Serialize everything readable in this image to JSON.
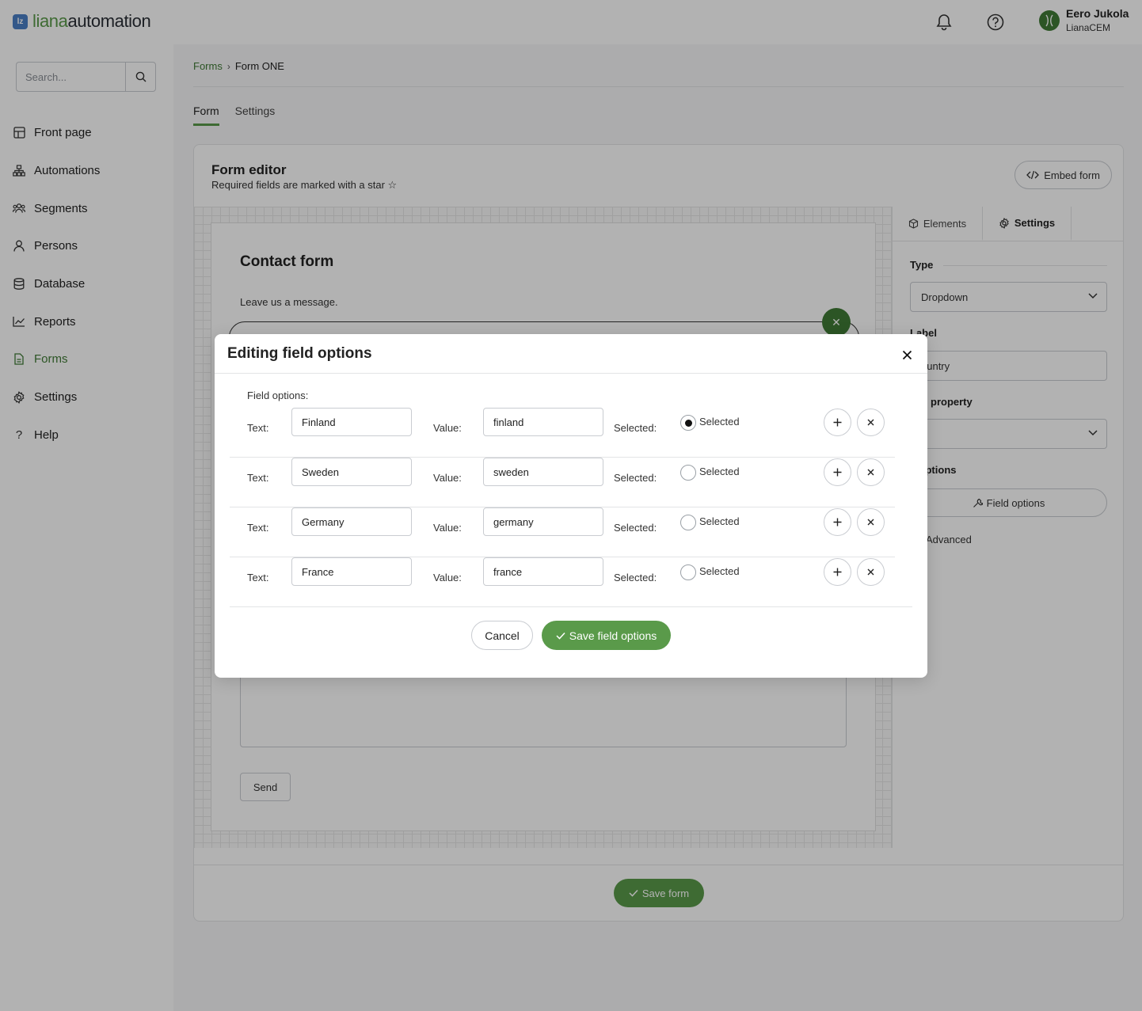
{
  "brand": {
    "logo_mark": "lz",
    "name_part1": "liana",
    "name_part2": "automation",
    "color": "#5a9a4a"
  },
  "topbar": {
    "notifications_icon": "bell-icon",
    "help_icon": "question-circle-icon"
  },
  "user": {
    "name": "Eero Jukola",
    "org": "LianaCEM"
  },
  "search": {
    "placeholder": "Search..."
  },
  "sidebar": {
    "items": [
      {
        "label": "Front page",
        "icon": "grid-icon"
      },
      {
        "label": "Automations",
        "icon": "flow-icon"
      },
      {
        "label": "Segments",
        "icon": "users-icon"
      },
      {
        "label": "Persons",
        "icon": "person-icon"
      },
      {
        "label": "Database",
        "icon": "database-icon"
      },
      {
        "label": "Reports",
        "icon": "chart-icon"
      },
      {
        "label": "Forms",
        "icon": "document-icon",
        "active": true
      },
      {
        "label": "Settings",
        "icon": "gear-icon"
      },
      {
        "label": "Help",
        "icon": "question-icon"
      }
    ]
  },
  "breadcrumb": {
    "parent": "Forms",
    "current": "Form ONE"
  },
  "tabs": [
    {
      "label": "Form",
      "active": true
    },
    {
      "label": "Settings",
      "active": false
    }
  ],
  "editor": {
    "title": "Form editor",
    "subtitle": "Required fields are marked with a star ☆",
    "embed_label": "Embed form",
    "save_form_label": "Save form"
  },
  "form_preview": {
    "heading": "Contact form",
    "intro": "Leave us a message.",
    "send_label": "Send"
  },
  "side_panel": {
    "tabs": [
      {
        "label": "Elements"
      },
      {
        "label": "Settings",
        "active": true
      }
    ],
    "type_label": "Type",
    "type_value": "Dropdown",
    "label_label": "Label",
    "label_value": "ountry",
    "linked_label": "ked property",
    "linked_value": "",
    "field_options_heading": "d options",
    "field_options_button": "Field options",
    "advanced": "Advanced"
  },
  "modal": {
    "title": "Editing field options",
    "field_options_label": "Field options:",
    "text_label": "Text:",
    "value_label": "Value:",
    "selected_label": "Selected:",
    "radio_label": "Selected",
    "cancel_label": "Cancel",
    "save_label": "Save field options",
    "options": [
      {
        "text": "Finland",
        "value": "finland",
        "selected": true
      },
      {
        "text": "Sweden",
        "value": "sweden",
        "selected": false
      },
      {
        "text": "Germany",
        "value": "germany",
        "selected": false
      },
      {
        "text": "France",
        "value": "france",
        "selected": false
      }
    ]
  },
  "colors": {
    "accent": "#5a9a4a",
    "accent_dark": "#3f7a35",
    "overlay": "rgba(0,0,0,0.3)"
  }
}
